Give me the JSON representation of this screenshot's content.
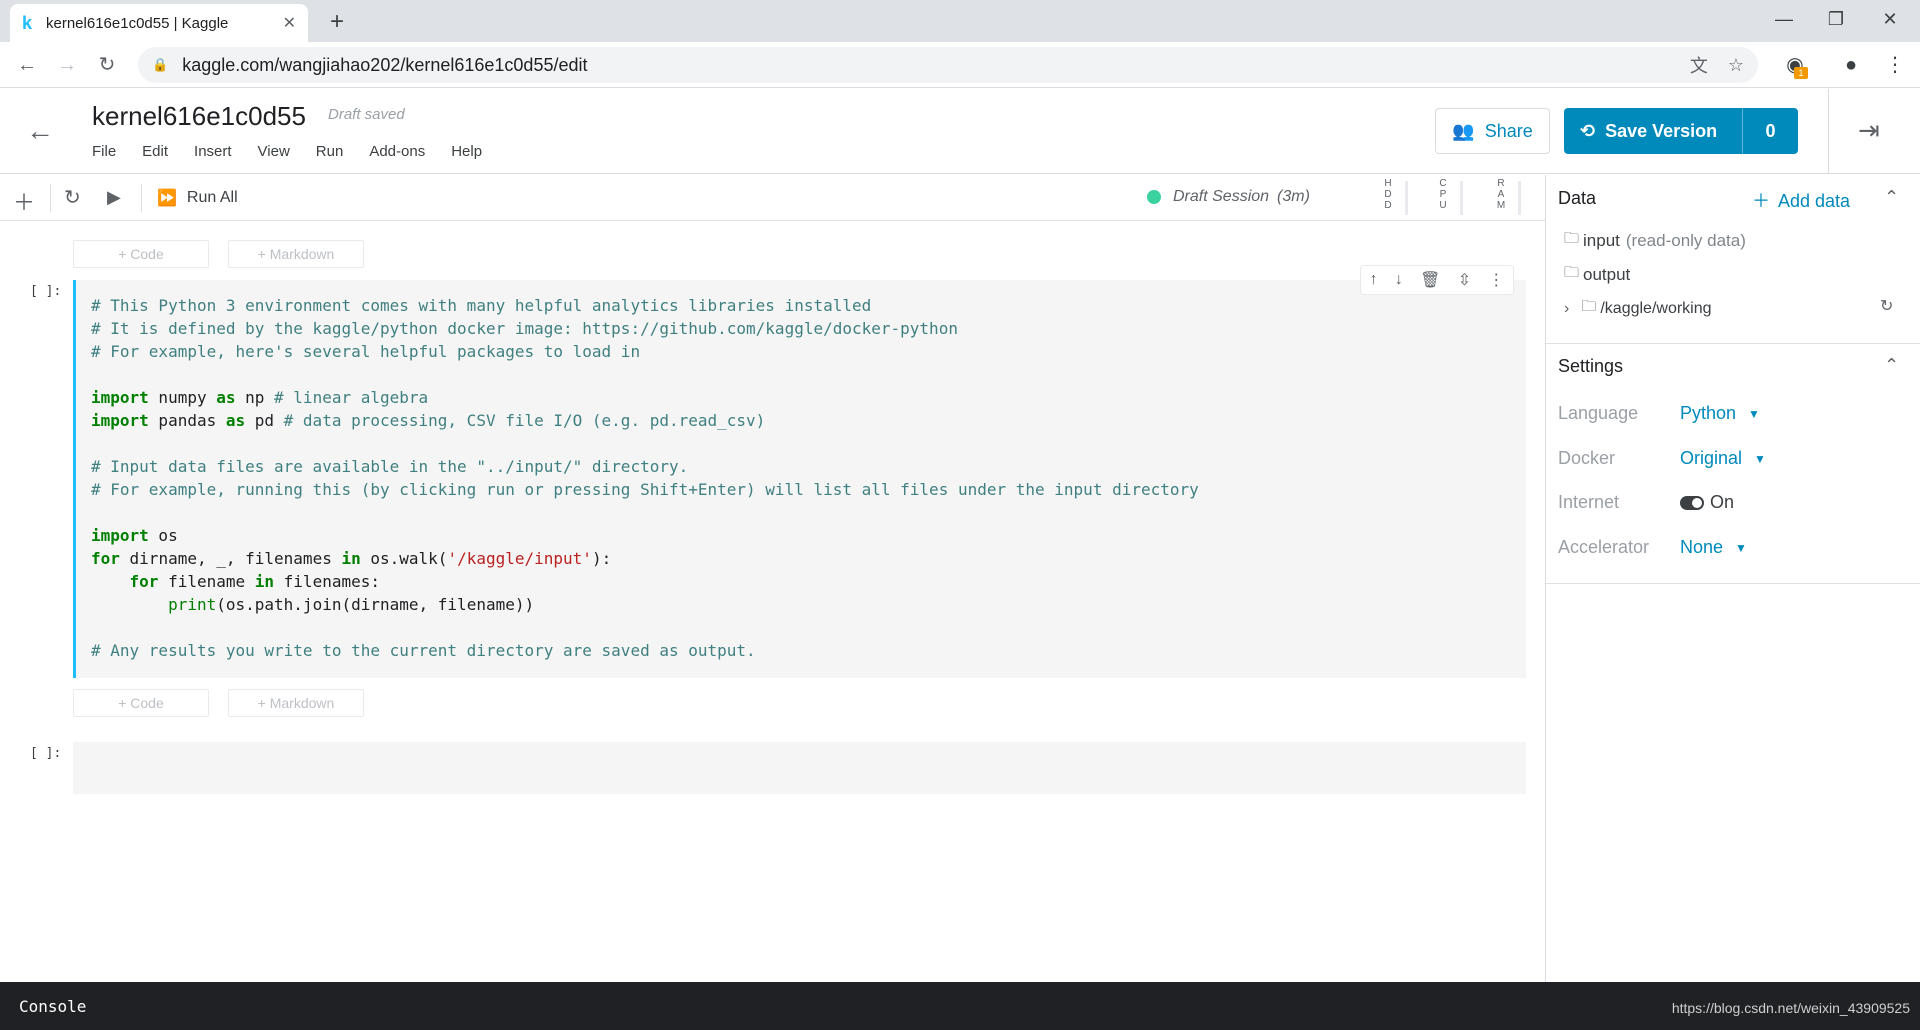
{
  "browser": {
    "tab_favicon": "k",
    "tab_title": "kernel616e1c0d55 | Kaggle",
    "url": "kaggle.com/wangjiahao202/kernel616e1c0d55/edit",
    "ext_badge": "1"
  },
  "header": {
    "kernel_name": "kernel616e1c0d55",
    "status": "Draft saved",
    "menu": [
      "File",
      "Edit",
      "Insert",
      "View",
      "Run",
      "Add-ons",
      "Help"
    ],
    "share_label": "Share",
    "save_label": "Save Version",
    "save_count": "0"
  },
  "toolbar": {
    "run_all_label": "Run All",
    "session_label": "Draft Session",
    "session_time": "(3m)",
    "meters": [
      "H D D",
      "C P U",
      "R A M"
    ]
  },
  "notebook": {
    "add_code_label": "+ Code",
    "add_markdown_label": "+ Markdown",
    "cell_prompt": "[ ]:",
    "cell1_lines": [
      "# This Python 3 environment comes with many helpful analytics libraries installed",
      "# It is defined by the kaggle/python docker image: https://github.com/kaggle/docker-python",
      "# For example, here's several helpful packages to load in",
      "",
      "import numpy as np # linear algebra",
      "import pandas as pd # data processing, CSV file I/O (e.g. pd.read_csv)",
      "",
      "# Input data files are available in the \"../input/\" directory.",
      "# For example, running this (by clicking run or pressing Shift+Enter) will list all files under the input directory",
      "",
      "import os",
      "for dirname, _, filenames in os.walk('/kaggle/input'):",
      "    for filename in filenames:",
      "        print(os.path.join(dirname, filename))",
      "",
      "# Any results you write to the current directory are saved as output."
    ]
  },
  "panel": {
    "data_title": "Data",
    "add_data_label": "Add data",
    "input_label": "input",
    "input_note": "(read-only data)",
    "output_label": "output",
    "working_label": "/kaggle/working",
    "settings_title": "Settings",
    "settings": [
      {
        "label": "Language",
        "value": "Python"
      },
      {
        "label": "Docker",
        "value": "Original"
      },
      {
        "label": "Internet",
        "value": "On"
      },
      {
        "label": "Accelerator",
        "value": "None"
      }
    ]
  },
  "console": {
    "label": "Console",
    "watermark": "https://blog.csdn.net/weixin_43909525"
  },
  "colors": {
    "accent": "#008abc",
    "session_dot": "#3ad29f",
    "active_cell": "#20beff"
  }
}
